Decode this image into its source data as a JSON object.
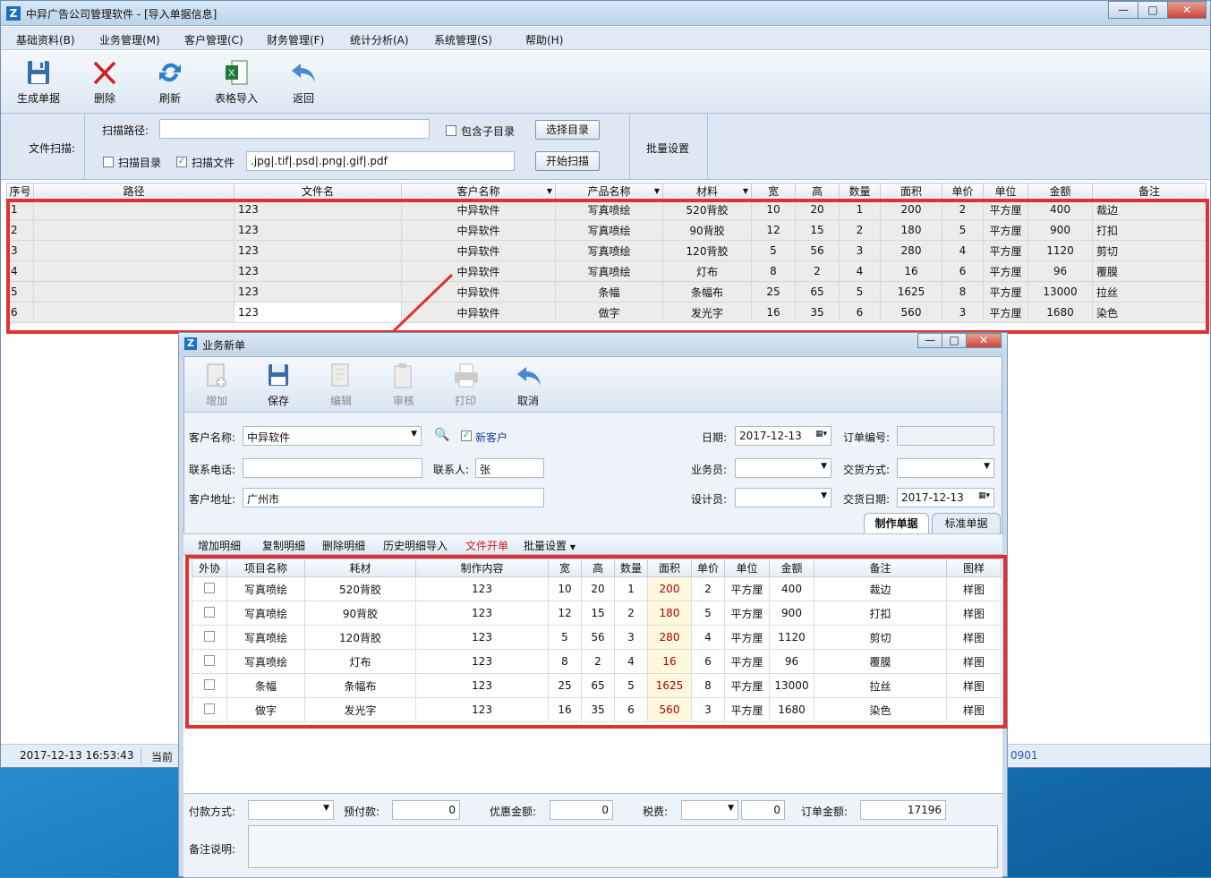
{
  "main_window": {
    "title": "中异广告公司管理软件 - [导入单据信息]",
    "controls": {
      "minimize": "—",
      "maximize": "□",
      "close": "✕"
    }
  },
  "menu": [
    "基础资料(B)",
    "业务管理(M)",
    "客户管理(C)",
    "财务管理(F)",
    "统计分析(A)",
    "系统管理(S)",
    "帮助(H)"
  ],
  "toolbar": {
    "generate": "生成单据",
    "delete": "删除",
    "refresh": "刷新",
    "import": "表格导入",
    "back": "返回"
  },
  "scan": {
    "section_label": "文件扫描:",
    "path_label": "扫描路径:",
    "path_value": "",
    "include_subdir": "包含子目录",
    "choose_dir": "选择目录",
    "scan_dir": "扫描目录",
    "scan_file": "扫描文件",
    "ext_value": ".jpg|.tif|.psd|.png|.gif|.pdf",
    "start_scan": "开始扫描",
    "batch": "批量设置"
  },
  "grid1": {
    "headers": [
      "序号",
      "路径",
      "文件名",
      "客户名称",
      "产品名称",
      "材料",
      "宽",
      "高",
      "数量",
      "面积",
      "单价",
      "单位",
      "金额",
      "备注"
    ],
    "rows": [
      [
        "1",
        "",
        "123",
        "中异软件",
        "写真喷绘",
        "520背胶",
        "10",
        "20",
        "1",
        "200",
        "2",
        "平方厘",
        "400",
        "裁边"
      ],
      [
        "2",
        "",
        "123",
        "中异软件",
        "写真喷绘",
        "90背胶",
        "12",
        "15",
        "2",
        "180",
        "5",
        "平方厘",
        "900",
        "打扣"
      ],
      [
        "3",
        "",
        "123",
        "中异软件",
        "写真喷绘",
        "120背胶",
        "5",
        "56",
        "3",
        "280",
        "4",
        "平方厘",
        "1120",
        "剪切"
      ],
      [
        "4",
        "",
        "123",
        "中异软件",
        "写真喷绘",
        "灯布",
        "8",
        "2",
        "4",
        "16",
        "6",
        "平方厘",
        "96",
        "覆膜"
      ],
      [
        "5",
        "",
        "123",
        "中异软件",
        "条幅",
        "条幅布",
        "25",
        "65",
        "5",
        "1625",
        "8",
        "平方厘",
        "13000",
        "拉丝"
      ],
      [
        "6",
        "",
        "123",
        "中异软件",
        "做字",
        "发光字",
        "16",
        "35",
        "6",
        "560",
        "3",
        "平方厘",
        "1680",
        "染色"
      ]
    ]
  },
  "status": {
    "datetime": "2017-12-13 16:53:43",
    "current": "当前",
    "right": "0901"
  },
  "dialog": {
    "title": "业务新单",
    "controls": {
      "minimize": "—",
      "maximize": "□",
      "close": "✕"
    },
    "toolbar": {
      "add": "增加",
      "save": "保存",
      "edit": "编辑",
      "audit": "审核",
      "print": "打印",
      "cancel": "取消"
    },
    "form": {
      "customer_label": "客户名称:",
      "customer_value": "中异软件",
      "new_customer": "新客户",
      "date_label": "日期:",
      "date_value": "2017-12-13",
      "order_no_label": "订单编号:",
      "order_no_value": "",
      "phone_label": "联系电话:",
      "phone_value": "",
      "contact_label": "联系人:",
      "contact_value": "张",
      "salesman_label": "业务员:",
      "salesman_value": "",
      "delivery_label": "交货方式:",
      "delivery_value": "",
      "address_label": "客户地址:",
      "address_value": "广州市",
      "designer_label": "设计员:",
      "designer_value": "",
      "delivery_date_label": "交货日期:",
      "delivery_date_value": "2017-12-13"
    },
    "tabs": [
      "制作单据",
      "标准单据"
    ],
    "actions": [
      "增加明细",
      "复制明细",
      "删除明细",
      "历史明细导入",
      "文件开单",
      "批量设置"
    ],
    "grid2": {
      "headers": [
        "外协",
        "项目名称",
        "耗材",
        "制作内容",
        "宽",
        "高",
        "数量",
        "面积",
        "单价",
        "单位",
        "金额",
        "备注",
        "图样"
      ],
      "rows": [
        [
          "",
          "写真喷绘",
          "520背胶",
          "123",
          "10",
          "20",
          "1",
          "200",
          "2",
          "平方厘",
          "400",
          "裁边",
          "样图"
        ],
        [
          "",
          "写真喷绘",
          "90背胶",
          "123",
          "12",
          "15",
          "2",
          "180",
          "5",
          "平方厘",
          "900",
          "打扣",
          "样图"
        ],
        [
          "",
          "写真喷绘",
          "120背胶",
          "123",
          "5",
          "56",
          "3",
          "280",
          "4",
          "平方厘",
          "1120",
          "剪切",
          "样图"
        ],
        [
          "",
          "写真喷绘",
          "灯布",
          "123",
          "8",
          "2",
          "4",
          "16",
          "6",
          "平方厘",
          "96",
          "覆膜",
          "样图"
        ],
        [
          "",
          "条幅",
          "条幅布",
          "123",
          "25",
          "65",
          "5",
          "1625",
          "8",
          "平方厘",
          "13000",
          "拉丝",
          "样图"
        ],
        [
          "",
          "做字",
          "发光字",
          "123",
          "16",
          "35",
          "6",
          "560",
          "3",
          "平方厘",
          "1680",
          "染色",
          "样图"
        ]
      ]
    },
    "footer": {
      "pay_label": "付款方式:",
      "pay_value": "",
      "prepay_label": "预付款:",
      "prepay_value": "0",
      "discount_label": "优惠金额:",
      "discount_value": "0",
      "tax_label": "税费:",
      "tax_value": "0",
      "total_label": "订单金额:",
      "total_value": "17196",
      "remark_label": "备注说明:",
      "remark_value": ""
    }
  },
  "colors": {
    "highlight": "#e23030",
    "accent": "#1f6fbf"
  }
}
